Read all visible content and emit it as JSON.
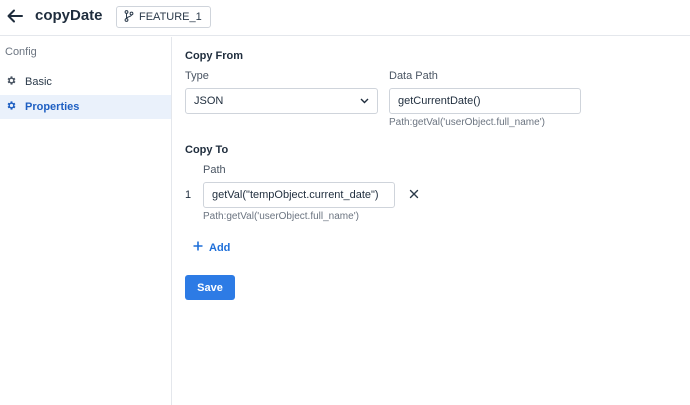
{
  "header": {
    "title": "copyDate",
    "branch": "FEATURE_1"
  },
  "sidebar": {
    "section_label": "Config",
    "items": [
      {
        "label": "Basic",
        "icon": "gear-icon",
        "active": false
      },
      {
        "label": "Properties",
        "icon": "gear-icon",
        "active": true
      }
    ]
  },
  "copy_from": {
    "title": "Copy From",
    "type_label": "Type",
    "type_value": "JSON",
    "data_path_label": "Data Path",
    "data_path_value": "getCurrentDate()",
    "data_path_hint": "Path:getVal('userObject.full_name')"
  },
  "copy_to": {
    "title": "Copy To",
    "path_label": "Path",
    "rows": [
      {
        "index": "1",
        "value": "getVal(\"tempObject.current_date\")",
        "hint": "Path:getVal('userObject.full_name')"
      }
    ],
    "add_label": "Add"
  },
  "actions": {
    "save_label": "Save"
  },
  "colors": {
    "accent": "#2d7be5",
    "active_bg": "#eaf1fb",
    "active_text": "#1e5fc2"
  }
}
